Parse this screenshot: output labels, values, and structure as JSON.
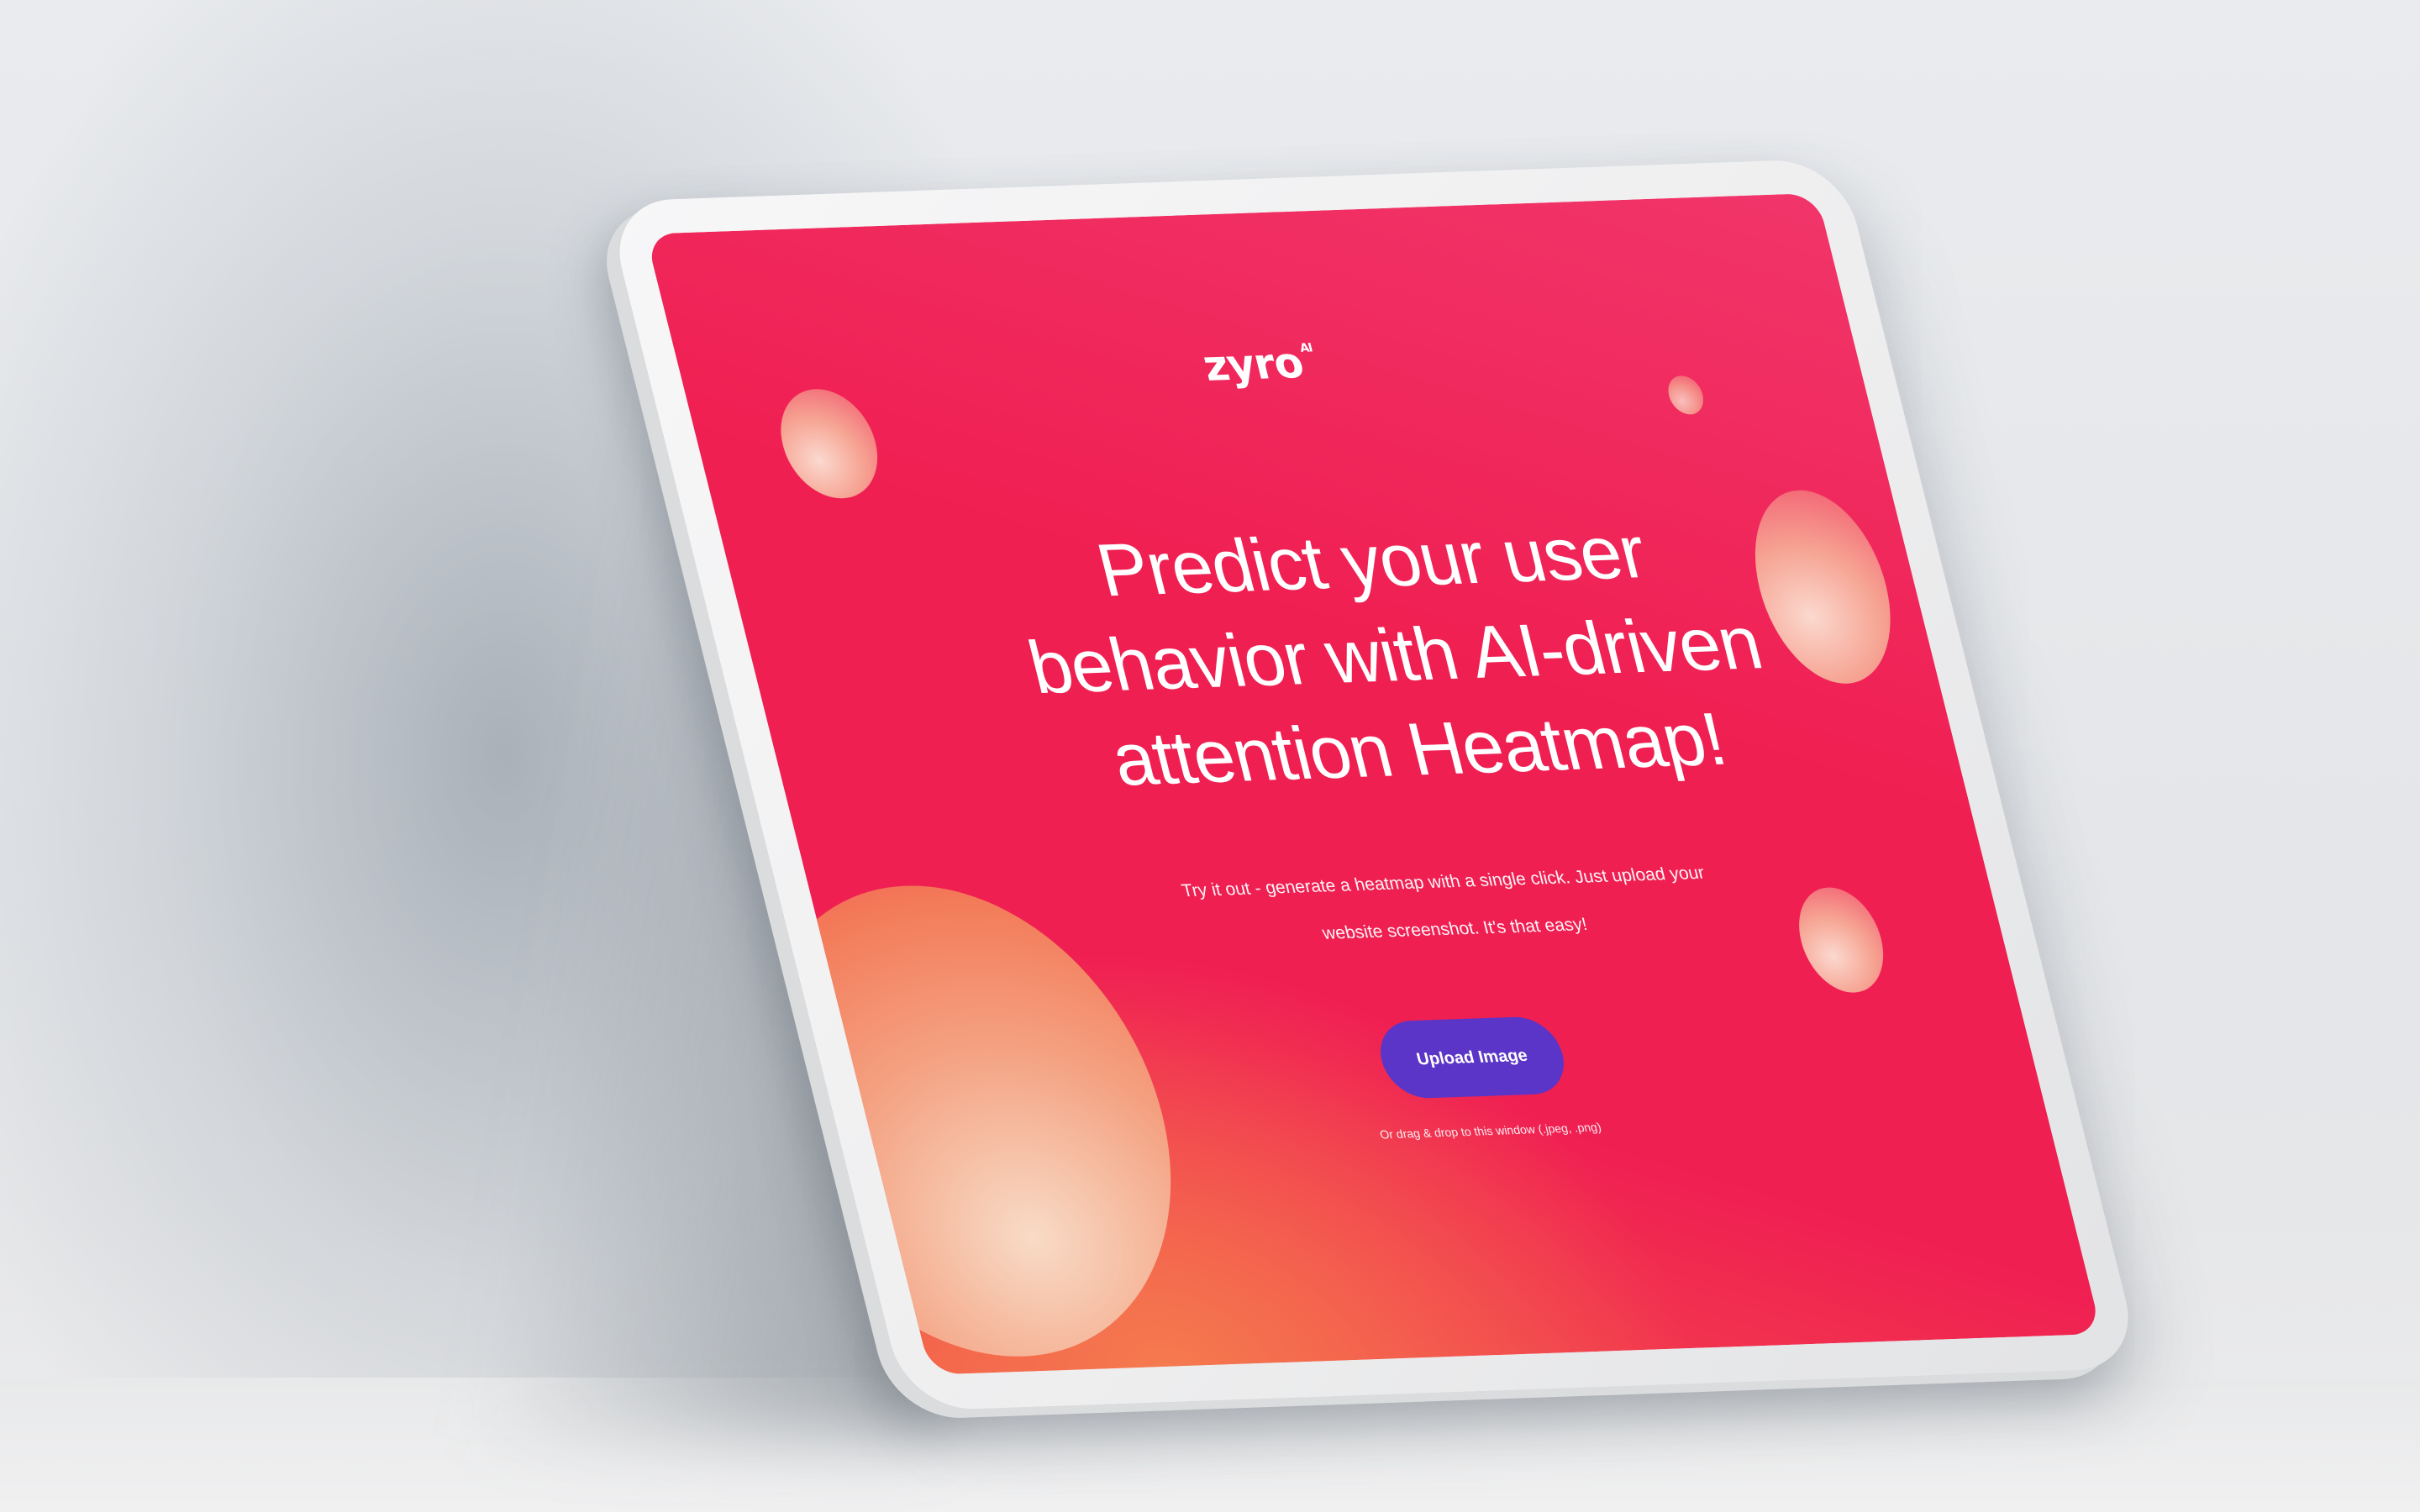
{
  "brand": {
    "logo_text": "zyro",
    "logo_superscript": "AI"
  },
  "hero": {
    "headline": "Predict your user behavior with AI-driven attention Heatmap!",
    "subtext": "Try it out - generate a heatmap with a single click. Just upload your website screenshot. It's that easy!",
    "upload_button_label": "Upload Image",
    "drop_hint": "Or drag & drop to this window (.jpeg, .png)"
  },
  "colors": {
    "accent": "#f01f52",
    "button": "#5b35c7"
  }
}
